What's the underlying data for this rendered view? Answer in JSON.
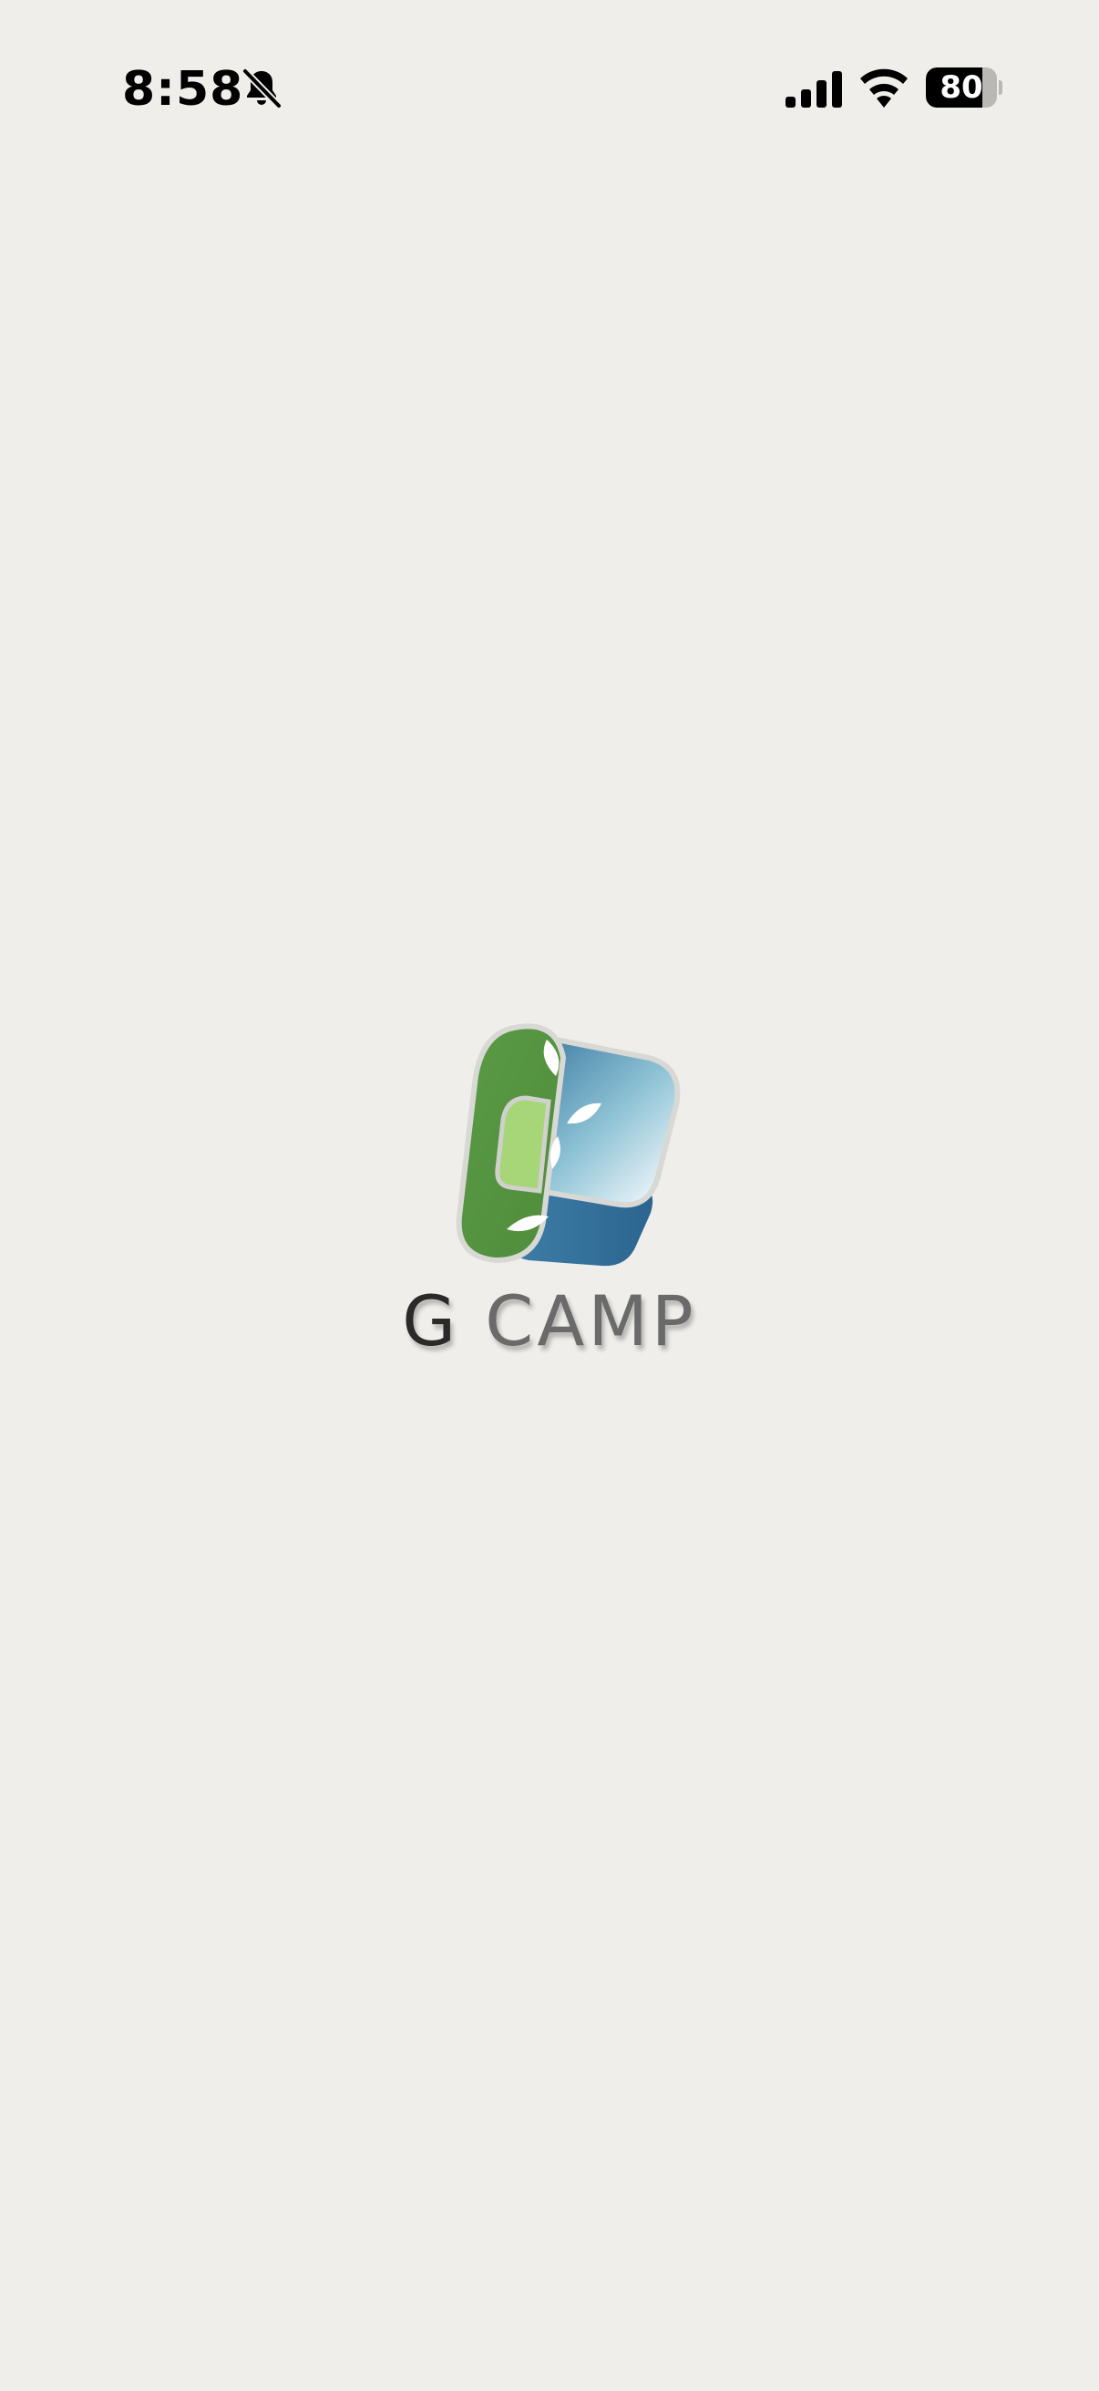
{
  "status_bar": {
    "time": "8:58",
    "battery_percent": 80,
    "battery_label": "80",
    "icons": [
      "bell-slash-icon",
      "cellular-signal-icon",
      "wifi-icon",
      "battery-icon"
    ]
  },
  "splash": {
    "logo_letter": "G",
    "logo_word": "CAMP",
    "colors": {
      "background": "#efeeea",
      "green": "#5a9a45",
      "light_green": "#a6d678",
      "blue": "#2e6e98",
      "light_blue": "#8fc3d6"
    }
  }
}
